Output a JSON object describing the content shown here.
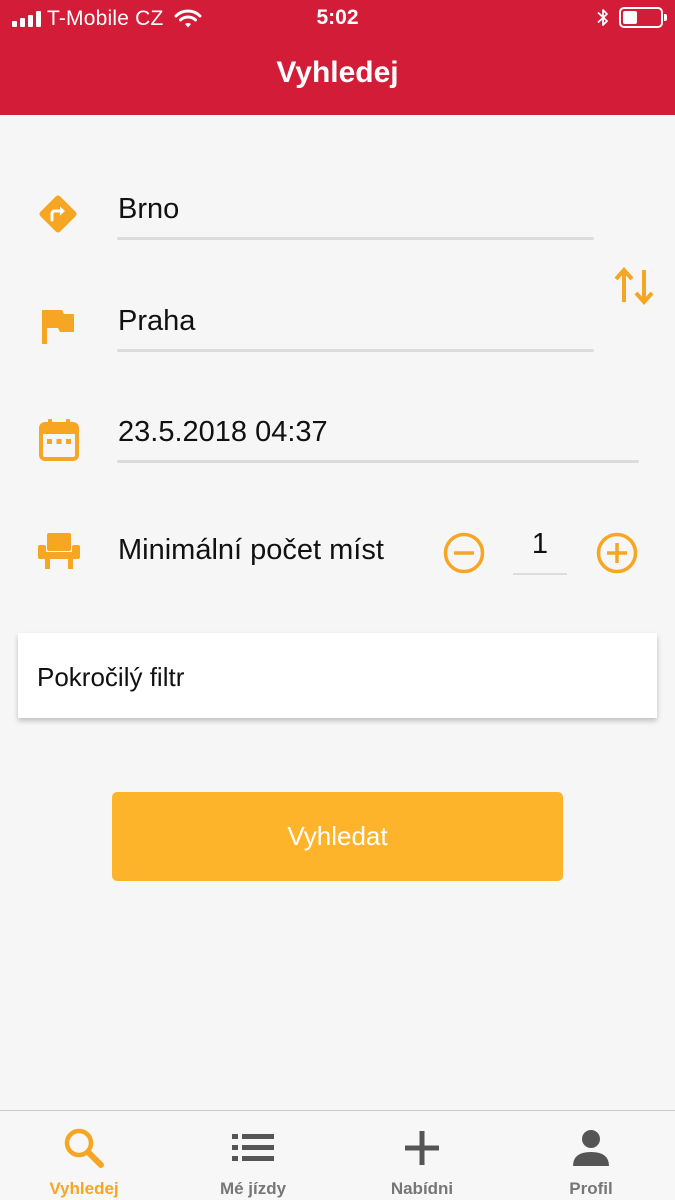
{
  "status_bar": {
    "carrier": "T-Mobile CZ",
    "time": "5:02"
  },
  "header": {
    "title": "Vyhledej"
  },
  "form": {
    "from": {
      "value": "Brno",
      "icon": "route-icon"
    },
    "to": {
      "value": "Praha",
      "icon": "flag-icon"
    },
    "datetime": {
      "value": "23.5.2018 04:37",
      "icon": "calendar-icon"
    },
    "seats": {
      "label": "Minimální počet míst",
      "value": "1",
      "icon": "seat-icon"
    },
    "swap_icon": "swap-arrows-icon"
  },
  "advanced_filter": {
    "label": "Pokročilý filtr"
  },
  "search_button": {
    "label": "Vyhledat"
  },
  "tabs": [
    {
      "label": "Vyhledej",
      "icon": "search-icon",
      "active": true
    },
    {
      "label": "Mé jízdy",
      "icon": "list-icon",
      "active": false
    },
    {
      "label": "Nabídni",
      "icon": "plus-icon",
      "active": false
    },
    {
      "label": "Profil",
      "icon": "person-icon",
      "active": false
    }
  ],
  "colors": {
    "header": "#d31c37",
    "accent": "#f6a623",
    "button": "#fdb32a",
    "inactive_tab": "#777777"
  }
}
